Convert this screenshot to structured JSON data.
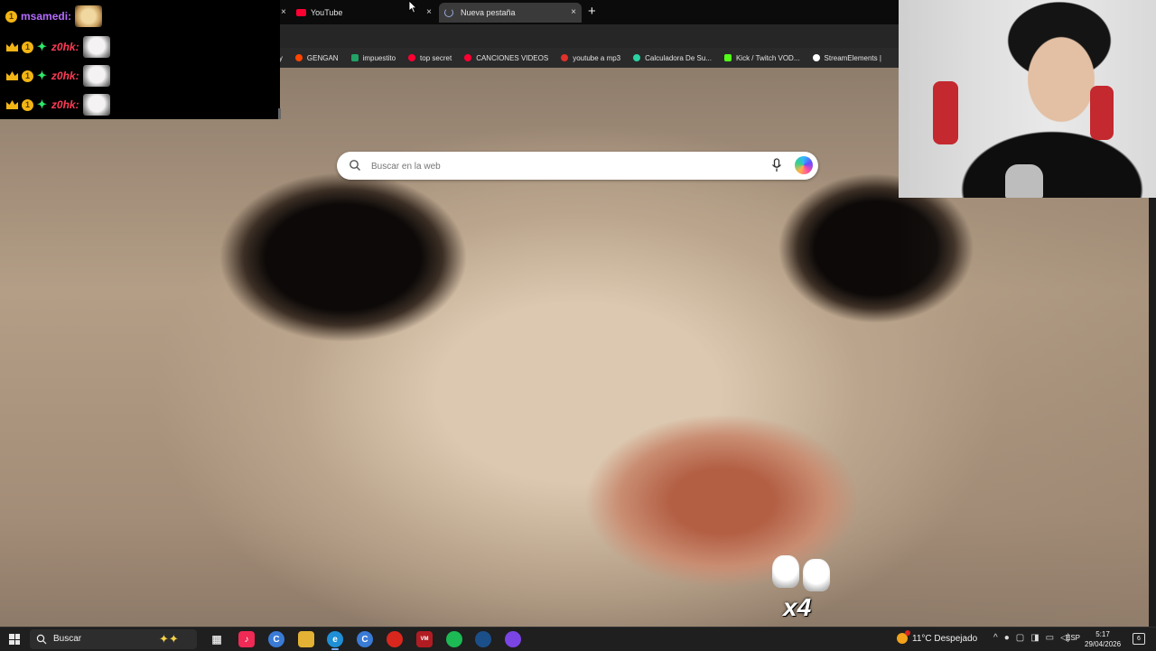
{
  "browser": {
    "tabs": [
      {
        "label": "YouTube",
        "favicon_color": "#ff0033"
      },
      {
        "label": "Nueva pestaña",
        "active": true
      }
    ],
    "new_tab_glyph": "+",
    "close_glyph": "×",
    "bookmarks": [
      {
        "label": "gey",
        "icon_color": "#000000"
      },
      {
        "label": "GENGAN",
        "icon_color": "#ff4500"
      },
      {
        "label": "impuestito",
        "icon_color": "#21a366"
      },
      {
        "label": "top secret",
        "icon_color": "#ff0033"
      },
      {
        "label": "CANCIONES VIDEOS",
        "icon_color": "#ff0033"
      },
      {
        "label": "youtube a mp3",
        "icon_color": "#e0312b"
      },
      {
        "label": "Calculadora De Su...",
        "icon_color": "#2bd3a3"
      },
      {
        "label": "Kick / Twitch VOD...",
        "icon_color": "#53fc18"
      },
      {
        "label": "StreamElements |",
        "icon_color": "#ffffff"
      }
    ]
  },
  "search": {
    "placeholder": "Buscar en la web"
  },
  "chat": {
    "messages": [
      {
        "badge_count": "1",
        "username": "msamedi:"
      },
      {
        "badge_count": "1",
        "username": "z0hk:"
      },
      {
        "badge_count": "1",
        "username": "z0hk:"
      },
      {
        "badge_count": "1",
        "username": "z0hk:"
      }
    ]
  },
  "overlay": {
    "gift_multiplier": "x4"
  },
  "taskbar": {
    "search_label": "Buscar",
    "weather": "11°C  Despejado",
    "language": "ESP",
    "time": "5:17",
    "date": "29/04/2026",
    "notifications": "6",
    "colors": {
      "accent": "#7ab0ff"
    }
  }
}
